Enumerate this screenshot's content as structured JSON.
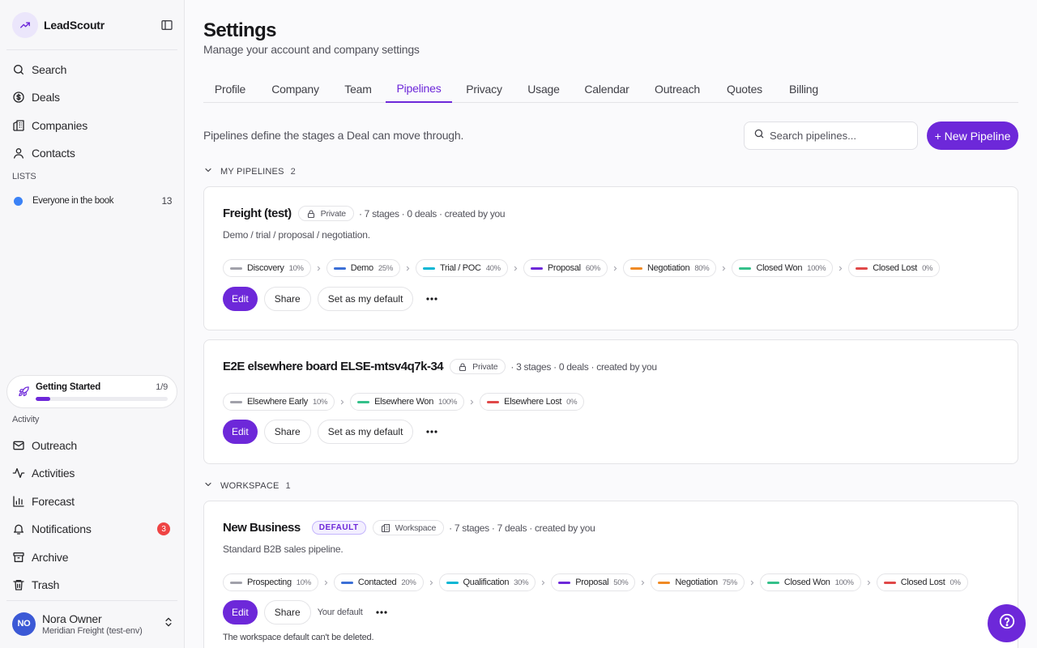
{
  "app": {
    "name": "LeadScoutr"
  },
  "sidebar": {
    "nav": [
      {
        "label": "Search",
        "icon": "search-icon"
      },
      {
        "label": "Deals",
        "icon": "dollar-icon"
      },
      {
        "label": "Companies",
        "icon": "building-icon"
      },
      {
        "label": "Contacts",
        "icon": "user-icon"
      }
    ],
    "lists_label": "LISTS",
    "lists": [
      {
        "label": "Everyone in the book",
        "count": "13",
        "color": "#3b82f6"
      }
    ],
    "getting_started": {
      "label": "Getting Started",
      "count": "1/9",
      "progress": 0.11
    },
    "activity_label": "Activity",
    "activity": [
      {
        "label": "Outreach",
        "icon": "mail-icon"
      },
      {
        "label": "Activities",
        "icon": "activity-icon"
      },
      {
        "label": "Forecast",
        "icon": "chart-icon"
      },
      {
        "label": "Notifications",
        "icon": "bell-icon",
        "badge": "3"
      },
      {
        "label": "Archive",
        "icon": "archive-icon"
      },
      {
        "label": "Trash",
        "icon": "trash-icon"
      }
    ],
    "user": {
      "initials": "NO",
      "name": "Nora Owner",
      "org": "Meridian Freight (test-env)"
    }
  },
  "page": {
    "title": "Settings",
    "subtitle": "Manage your account and company settings",
    "tabs": [
      "Profile",
      "Company",
      "Team",
      "Pipelines",
      "Privacy",
      "Usage",
      "Calendar",
      "Outreach",
      "Quotes",
      "Billing"
    ],
    "active_tab": "Pipelines",
    "intro": "Pipelines define the stages a Deal can move through.",
    "search_placeholder": "Search pipelines...",
    "new_button": "+ New Pipeline"
  },
  "groups": {
    "mine": {
      "label": "MY PIPELINES",
      "count": "2"
    },
    "workspace": {
      "label": "WORKSPACE",
      "count": "1"
    }
  },
  "pipelines": [
    {
      "name": "Freight (test)",
      "visibility": "Private",
      "meta": "· 7 stages · 0 deals · created by you",
      "description": "Demo / trial / proposal / negotiation.",
      "stages": [
        {
          "name": "Discovery",
          "pct": "10%",
          "color": "#a1a1aa"
        },
        {
          "name": "Demo",
          "pct": "25%",
          "color": "#3b6fd6"
        },
        {
          "name": "Trial / POC",
          "pct": "40%",
          "color": "#06b6d4"
        },
        {
          "name": "Proposal",
          "pct": "60%",
          "color": "#6d28d9"
        },
        {
          "name": "Negotiation",
          "pct": "80%",
          "color": "#f08a24"
        },
        {
          "name": "Closed Won",
          "pct": "100%",
          "color": "#34c08a"
        },
        {
          "name": "Closed Lost",
          "pct": "0%",
          "color": "#e04848"
        }
      ],
      "actions": {
        "edit": "Edit",
        "share": "Share",
        "default": "Set as my default"
      }
    },
    {
      "name": "E2E elsewhere board ELSE-mtsv4q7k-34",
      "visibility": "Private",
      "meta": "· 3 stages · 0 deals · created by you",
      "stages": [
        {
          "name": "Elsewhere Early",
          "pct": "10%",
          "color": "#a1a1aa"
        },
        {
          "name": "Elsewhere Won",
          "pct": "100%",
          "color": "#34c08a"
        },
        {
          "name": "Elsewhere Lost",
          "pct": "0%",
          "color": "#e04848"
        }
      ],
      "actions": {
        "edit": "Edit",
        "share": "Share",
        "default": "Set as my default"
      }
    },
    {
      "name": "New Business",
      "badge": "DEFAULT",
      "visibility": "Workspace",
      "meta": "· 7 stages · 7 deals · created by you",
      "description": "Standard B2B sales pipeline.",
      "stages": [
        {
          "name": "Prospecting",
          "pct": "10%",
          "color": "#a1a1aa"
        },
        {
          "name": "Contacted",
          "pct": "20%",
          "color": "#3b6fd6"
        },
        {
          "name": "Qualification",
          "pct": "30%",
          "color": "#06b6d4"
        },
        {
          "name": "Proposal",
          "pct": "50%",
          "color": "#6d28d9"
        },
        {
          "name": "Negotiation",
          "pct": "75%",
          "color": "#f08a24"
        },
        {
          "name": "Closed Won",
          "pct": "100%",
          "color": "#34c08a"
        },
        {
          "name": "Closed Lost",
          "pct": "0%",
          "color": "#e04848"
        }
      ],
      "actions": {
        "edit": "Edit",
        "share": "Share",
        "your_default": "Your default"
      },
      "note": "The workspace default can't be deleted."
    }
  ],
  "colors": {
    "accent": "#6d28d9",
    "list_dot": "#3b82f6",
    "badge": "#ef4444"
  },
  "help_icon": "help-icon"
}
